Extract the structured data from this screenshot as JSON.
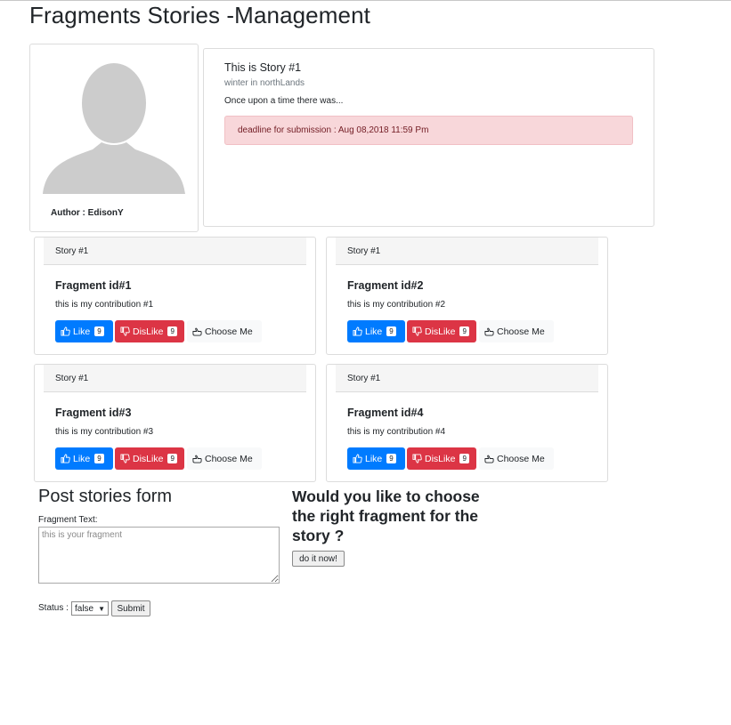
{
  "page": {
    "title": "Fragments Stories -Management"
  },
  "author": {
    "label": "Author : EdisonY"
  },
  "story": {
    "title": "This is Story #1",
    "subtitle": "winter in northLands",
    "text": "Once upon a time there was...",
    "deadline": "deadline for submission : Aug 08,2018 11:59 Pm"
  },
  "fragments": [
    {
      "story": "Story #1",
      "title": "Fragment id#1",
      "text": "this is my contribution #1",
      "like_label": "Like",
      "like_count": "9",
      "dislike_label": "DisLike",
      "dislike_count": "9",
      "choose_label": "Choose Me"
    },
    {
      "story": "Story #1",
      "title": "Fragment id#2",
      "text": "this is my contribution #2",
      "like_label": "Like",
      "like_count": "9",
      "dislike_label": "DisLike",
      "dislike_count": "9",
      "choose_label": "Choose Me"
    },
    {
      "story": "Story #1",
      "title": "Fragment id#3",
      "text": "this is my contribution #3",
      "like_label": "Like",
      "like_count": "9",
      "dislike_label": "DisLike",
      "dislike_count": "9",
      "choose_label": "Choose Me"
    },
    {
      "story": "Story #1",
      "title": "Fragment id#4",
      "text": "this is my contribution #4",
      "like_label": "Like",
      "like_count": "9",
      "dislike_label": "DisLike",
      "dislike_count": "9",
      "choose_label": "Choose Me"
    }
  ],
  "form": {
    "title": "Post stories form",
    "fragment_label": "Fragment Text:",
    "fragment_placeholder": "this is your fragment",
    "status_label": "Status :",
    "status_value": "false",
    "submit_label": "Submit"
  },
  "choose_section": {
    "question": "Would you like to choose the right fragment for the story ?",
    "button_label": "do it now!"
  },
  "colors": {
    "like": "#007bff",
    "dislike": "#dc3545",
    "alert_bg": "#f8d7da",
    "alert_text": "#721c24"
  },
  "icons": {
    "like": "thumbs-up-icon",
    "dislike": "thumbs-down-icon",
    "choose": "hand-pointer-icon",
    "avatar": "user-silhouette-icon"
  }
}
